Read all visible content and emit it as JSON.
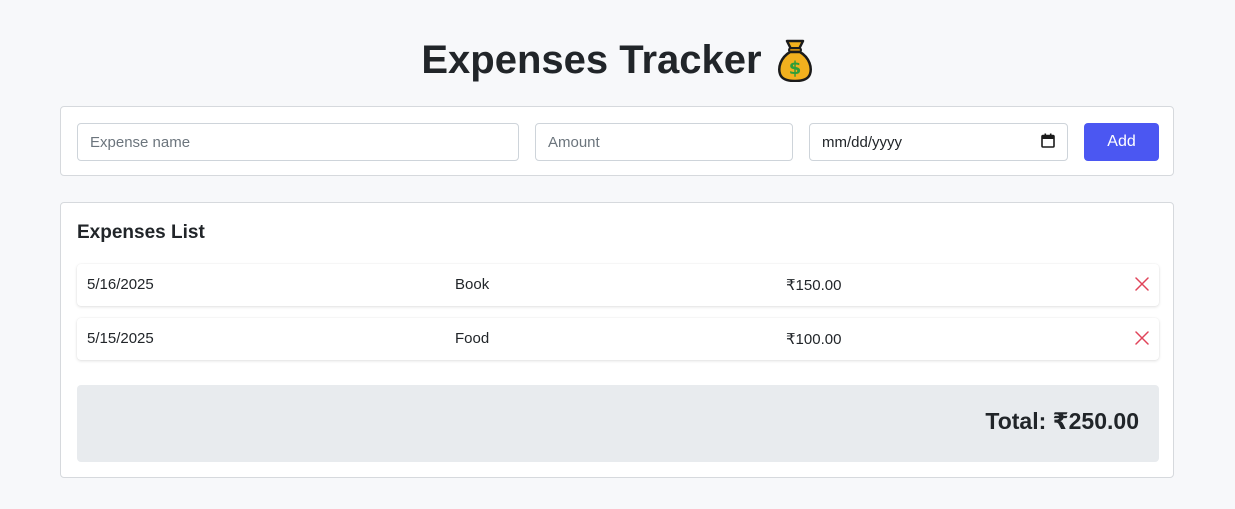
{
  "header": {
    "title": "Expenses Tracker",
    "icon": "money-bag-icon"
  },
  "form": {
    "name_placeholder": "Expense name",
    "amount_placeholder": "Amount",
    "date_placeholder": "mm/dd/yyyy",
    "add_label": "Add"
  },
  "list": {
    "heading": "Expenses List",
    "rows": [
      {
        "date": "5/16/2025",
        "name": "Book",
        "amount": "₹150.00"
      },
      {
        "date": "5/15/2025",
        "name": "Food",
        "amount": "₹100.00"
      }
    ],
    "total_label": "Total: ₹250.00"
  },
  "colors": {
    "accent": "#4b57f2",
    "delete": "#e0445a",
    "total_bg": "#e8ebee"
  }
}
